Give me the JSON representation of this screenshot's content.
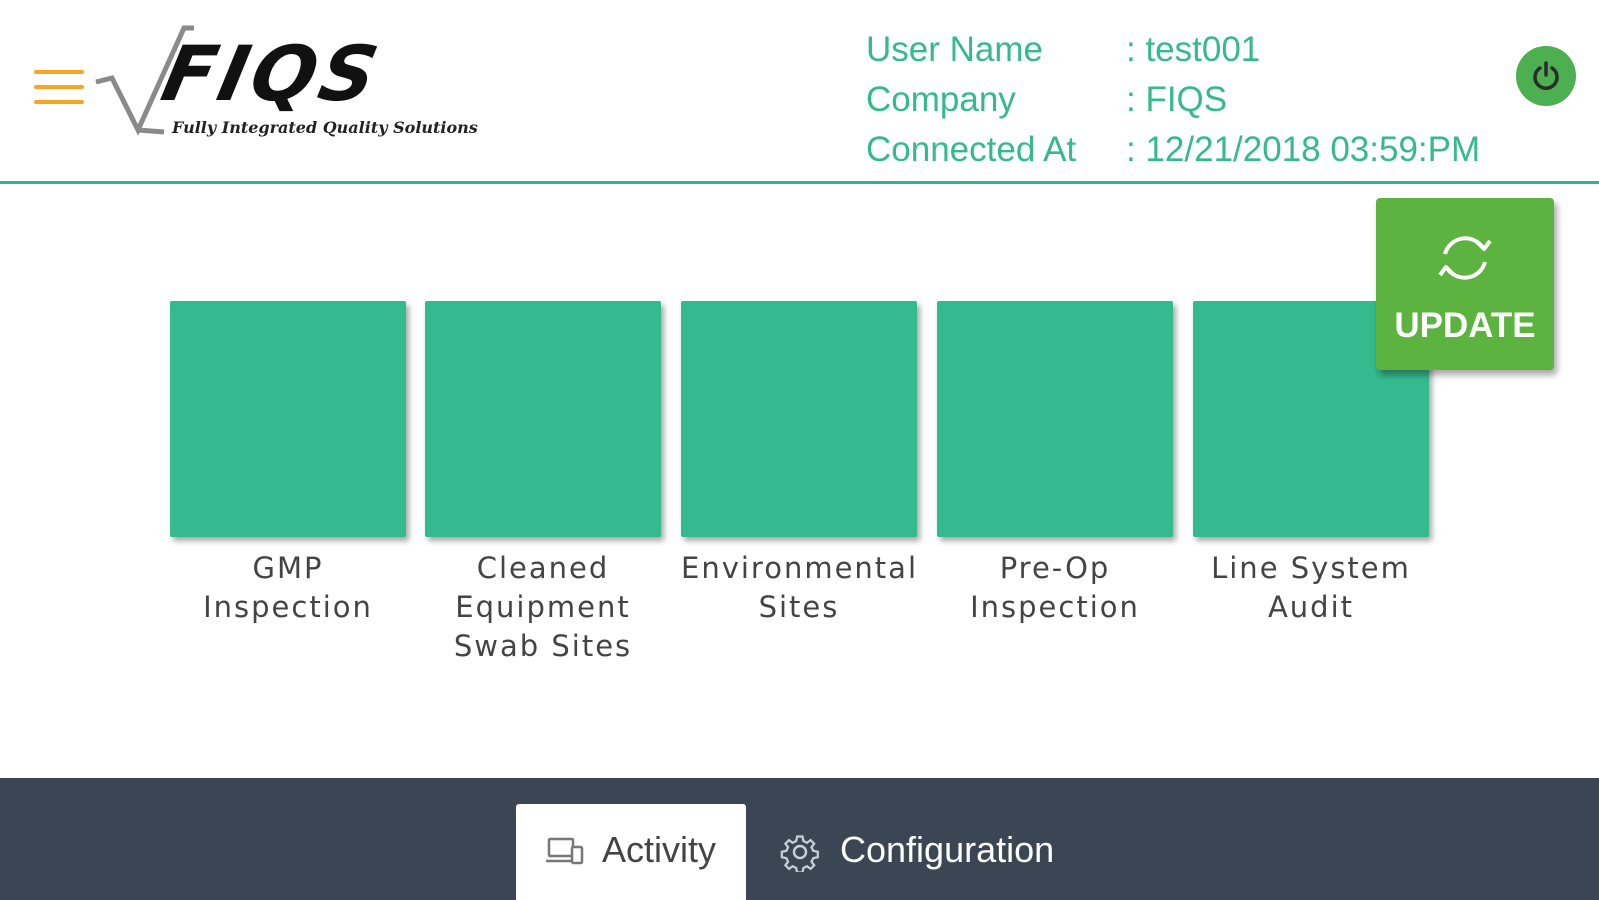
{
  "header": {
    "logo_text": "FIQS",
    "logo_tagline": "Fully Integrated Quality Solutions",
    "user_info": [
      {
        "label": "User Name",
        "value": ": test001"
      },
      {
        "label": "Company",
        "value": ": FIQS"
      },
      {
        "label": "Connected At",
        "value": ": 12/21/2018 03:59:PM"
      }
    ]
  },
  "tiles": [
    {
      "label": "GMP Inspection"
    },
    {
      "label": "Cleaned Equipment Swab Sites"
    },
    {
      "label": "Environmental Sites"
    },
    {
      "label": "Pre-Op Inspection"
    },
    {
      "label": "Line System Audit"
    }
  ],
  "update_button": {
    "label": "UPDATE"
  },
  "bottom_tabs": [
    {
      "label": "Activity",
      "icon": "devices-icon",
      "active": true
    },
    {
      "label": "Configuration",
      "icon": "gear-icon",
      "active": false
    }
  ],
  "colors": {
    "accent": "#35b98f",
    "menu": "#f5a623",
    "power": "#4caf50",
    "update": "#5db33f",
    "bottom_bar": "#3a4654"
  }
}
